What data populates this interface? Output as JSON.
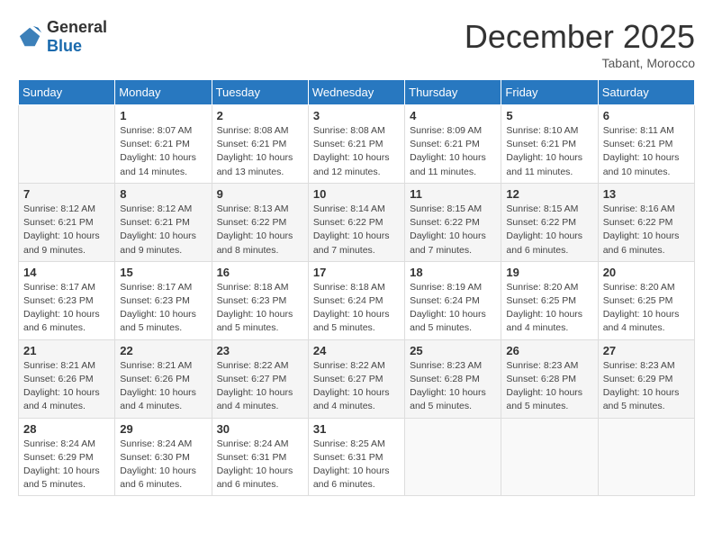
{
  "header": {
    "logo_general": "General",
    "logo_blue": "Blue",
    "month_title": "December 2025",
    "location": "Tabant, Morocco"
  },
  "days_of_week": [
    "Sunday",
    "Monday",
    "Tuesday",
    "Wednesday",
    "Thursday",
    "Friday",
    "Saturday"
  ],
  "weeks": [
    [
      {
        "day": "",
        "sunrise": "",
        "sunset": "",
        "daylight": ""
      },
      {
        "day": "1",
        "sunrise": "Sunrise: 8:07 AM",
        "sunset": "Sunset: 6:21 PM",
        "daylight": "Daylight: 10 hours and 14 minutes."
      },
      {
        "day": "2",
        "sunrise": "Sunrise: 8:08 AM",
        "sunset": "Sunset: 6:21 PM",
        "daylight": "Daylight: 10 hours and 13 minutes."
      },
      {
        "day": "3",
        "sunrise": "Sunrise: 8:08 AM",
        "sunset": "Sunset: 6:21 PM",
        "daylight": "Daylight: 10 hours and 12 minutes."
      },
      {
        "day": "4",
        "sunrise": "Sunrise: 8:09 AM",
        "sunset": "Sunset: 6:21 PM",
        "daylight": "Daylight: 10 hours and 11 minutes."
      },
      {
        "day": "5",
        "sunrise": "Sunrise: 8:10 AM",
        "sunset": "Sunset: 6:21 PM",
        "daylight": "Daylight: 10 hours and 11 minutes."
      },
      {
        "day": "6",
        "sunrise": "Sunrise: 8:11 AM",
        "sunset": "Sunset: 6:21 PM",
        "daylight": "Daylight: 10 hours and 10 minutes."
      }
    ],
    [
      {
        "day": "7",
        "sunrise": "Sunrise: 8:12 AM",
        "sunset": "Sunset: 6:21 PM",
        "daylight": "Daylight: 10 hours and 9 minutes."
      },
      {
        "day": "8",
        "sunrise": "Sunrise: 8:12 AM",
        "sunset": "Sunset: 6:21 PM",
        "daylight": "Daylight: 10 hours and 9 minutes."
      },
      {
        "day": "9",
        "sunrise": "Sunrise: 8:13 AM",
        "sunset": "Sunset: 6:22 PM",
        "daylight": "Daylight: 10 hours and 8 minutes."
      },
      {
        "day": "10",
        "sunrise": "Sunrise: 8:14 AM",
        "sunset": "Sunset: 6:22 PM",
        "daylight": "Daylight: 10 hours and 7 minutes."
      },
      {
        "day": "11",
        "sunrise": "Sunrise: 8:15 AM",
        "sunset": "Sunset: 6:22 PM",
        "daylight": "Daylight: 10 hours and 7 minutes."
      },
      {
        "day": "12",
        "sunrise": "Sunrise: 8:15 AM",
        "sunset": "Sunset: 6:22 PM",
        "daylight": "Daylight: 10 hours and 6 minutes."
      },
      {
        "day": "13",
        "sunrise": "Sunrise: 8:16 AM",
        "sunset": "Sunset: 6:22 PM",
        "daylight": "Daylight: 10 hours and 6 minutes."
      }
    ],
    [
      {
        "day": "14",
        "sunrise": "Sunrise: 8:17 AM",
        "sunset": "Sunset: 6:23 PM",
        "daylight": "Daylight: 10 hours and 6 minutes."
      },
      {
        "day": "15",
        "sunrise": "Sunrise: 8:17 AM",
        "sunset": "Sunset: 6:23 PM",
        "daylight": "Daylight: 10 hours and 5 minutes."
      },
      {
        "day": "16",
        "sunrise": "Sunrise: 8:18 AM",
        "sunset": "Sunset: 6:23 PM",
        "daylight": "Daylight: 10 hours and 5 minutes."
      },
      {
        "day": "17",
        "sunrise": "Sunrise: 8:18 AM",
        "sunset": "Sunset: 6:24 PM",
        "daylight": "Daylight: 10 hours and 5 minutes."
      },
      {
        "day": "18",
        "sunrise": "Sunrise: 8:19 AM",
        "sunset": "Sunset: 6:24 PM",
        "daylight": "Daylight: 10 hours and 5 minutes."
      },
      {
        "day": "19",
        "sunrise": "Sunrise: 8:20 AM",
        "sunset": "Sunset: 6:25 PM",
        "daylight": "Daylight: 10 hours and 4 minutes."
      },
      {
        "day": "20",
        "sunrise": "Sunrise: 8:20 AM",
        "sunset": "Sunset: 6:25 PM",
        "daylight": "Daylight: 10 hours and 4 minutes."
      }
    ],
    [
      {
        "day": "21",
        "sunrise": "Sunrise: 8:21 AM",
        "sunset": "Sunset: 6:26 PM",
        "daylight": "Daylight: 10 hours and 4 minutes."
      },
      {
        "day": "22",
        "sunrise": "Sunrise: 8:21 AM",
        "sunset": "Sunset: 6:26 PM",
        "daylight": "Daylight: 10 hours and 4 minutes."
      },
      {
        "day": "23",
        "sunrise": "Sunrise: 8:22 AM",
        "sunset": "Sunset: 6:27 PM",
        "daylight": "Daylight: 10 hours and 4 minutes."
      },
      {
        "day": "24",
        "sunrise": "Sunrise: 8:22 AM",
        "sunset": "Sunset: 6:27 PM",
        "daylight": "Daylight: 10 hours and 4 minutes."
      },
      {
        "day": "25",
        "sunrise": "Sunrise: 8:23 AM",
        "sunset": "Sunset: 6:28 PM",
        "daylight": "Daylight: 10 hours and 5 minutes."
      },
      {
        "day": "26",
        "sunrise": "Sunrise: 8:23 AM",
        "sunset": "Sunset: 6:28 PM",
        "daylight": "Daylight: 10 hours and 5 minutes."
      },
      {
        "day": "27",
        "sunrise": "Sunrise: 8:23 AM",
        "sunset": "Sunset: 6:29 PM",
        "daylight": "Daylight: 10 hours and 5 minutes."
      }
    ],
    [
      {
        "day": "28",
        "sunrise": "Sunrise: 8:24 AM",
        "sunset": "Sunset: 6:29 PM",
        "daylight": "Daylight: 10 hours and 5 minutes."
      },
      {
        "day": "29",
        "sunrise": "Sunrise: 8:24 AM",
        "sunset": "Sunset: 6:30 PM",
        "daylight": "Daylight: 10 hours and 6 minutes."
      },
      {
        "day": "30",
        "sunrise": "Sunrise: 8:24 AM",
        "sunset": "Sunset: 6:31 PM",
        "daylight": "Daylight: 10 hours and 6 minutes."
      },
      {
        "day": "31",
        "sunrise": "Sunrise: 8:25 AM",
        "sunset": "Sunset: 6:31 PM",
        "daylight": "Daylight: 10 hours and 6 minutes."
      },
      {
        "day": "",
        "sunrise": "",
        "sunset": "",
        "daylight": ""
      },
      {
        "day": "",
        "sunrise": "",
        "sunset": "",
        "daylight": ""
      },
      {
        "day": "",
        "sunrise": "",
        "sunset": "",
        "daylight": ""
      }
    ]
  ]
}
